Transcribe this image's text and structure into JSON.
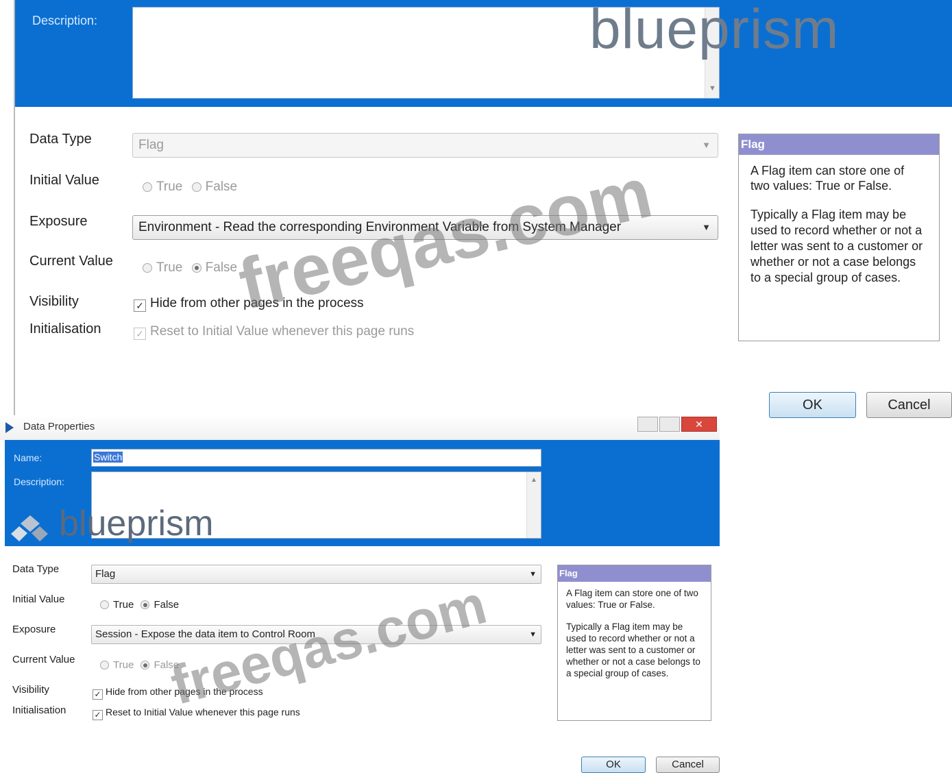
{
  "logo": {
    "text": "blueprism"
  },
  "watermark": "freeqas.com",
  "top_dialog": {
    "description_label": "Description:",
    "description_value": "",
    "fields": {
      "data_type": {
        "label": "Data Type",
        "value": "Flag"
      },
      "initial_value": {
        "label": "Initial Value",
        "true_label": "True",
        "false_label": "False",
        "selected": ""
      },
      "exposure": {
        "label": "Exposure",
        "value": "Environment - Read the corresponding Environment Variable from System Manager"
      },
      "current_value": {
        "label": "Current Value",
        "true_label": "True",
        "false_label": "False",
        "selected": "False"
      },
      "visibility": {
        "label": "Visibility",
        "checkbox_label": "Hide from other pages in the process",
        "checked": true
      },
      "initialisation": {
        "label": "Initialisation",
        "checkbox_label": "Reset to Initial Value whenever this page runs",
        "checked": true,
        "enabled": false
      }
    },
    "help": {
      "title": "Flag",
      "paragraph1": "A Flag item can store one of two values: True or False.",
      "paragraph2": "Typically a Flag item may be used to record whether or not a letter was sent to a customer or whether or not a case belongs to a special group of cases."
    },
    "buttons": {
      "ok": "OK",
      "cancel": "Cancel"
    }
  },
  "bottom_dialog": {
    "window_title": "Data Properties",
    "name_label": "Name:",
    "name_value": "Switch",
    "description_label": "Description:",
    "description_value": "",
    "fields": {
      "data_type": {
        "label": "Data Type",
        "value": "Flag"
      },
      "initial_value": {
        "label": "Initial Value",
        "true_label": "True",
        "false_label": "False",
        "selected": "False"
      },
      "exposure": {
        "label": "Exposure",
        "value": "Session - Expose the data item to Control Room"
      },
      "current_value": {
        "label": "Current Value",
        "true_label": "True",
        "false_label": "False",
        "selected": "False"
      },
      "visibility": {
        "label": "Visibility",
        "checkbox_label": "Hide from other pages in the process",
        "checked": true
      },
      "initialisation": {
        "label": "Initialisation",
        "checkbox_label": "Reset to Initial Value whenever this page runs",
        "checked": true,
        "enabled": true
      }
    },
    "help": {
      "title": "Flag",
      "paragraph1": "A Flag item can store one of two values: True or False.",
      "paragraph2": "Typically a Flag item may be used to record whether or not a letter was sent to a customer or whether or not a case belongs to a special group of cases."
    },
    "buttons": {
      "ok": "OK",
      "cancel": "Cancel"
    }
  },
  "colors": {
    "banner_blue": "#0b6fd1",
    "help_header": "#8f8fd0",
    "close_button": "#d9463c"
  }
}
